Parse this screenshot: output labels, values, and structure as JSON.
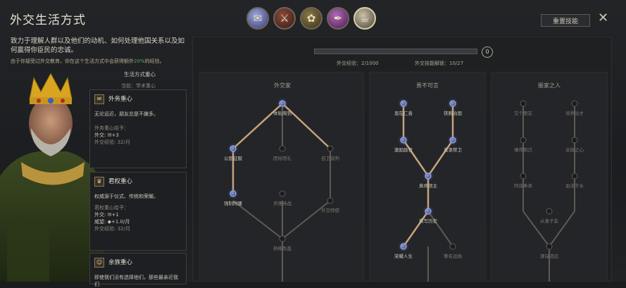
{
  "header": {
    "title": "外交生活方式",
    "reset_label": "重置技能",
    "close_glyph": "✕",
    "tabs": [
      {
        "name": "diplomacy-tab",
        "glyph": "✉",
        "active": false
      },
      {
        "name": "martial-tab",
        "glyph": "⚔",
        "active": false
      },
      {
        "name": "stewardship-tab",
        "glyph": "✿",
        "active": false
      },
      {
        "name": "intrigue-tab",
        "glyph": "✒",
        "active": false
      },
      {
        "name": "learning-tab",
        "glyph": "☕",
        "active": true
      }
    ]
  },
  "left": {
    "description": "致力于理解人群以及他们的动机、如何处理他国关系以及如何赢得你臣民的忠诚。",
    "education_note_pre": "由于你接受过外交教育，你在这个生活方式中会获得额外",
    "education_note_hl": "20%",
    "education_note_post": "的经验。",
    "lifestyle_focus_label": "生活方式重心",
    "current_label": "当前：学术重心",
    "cards": [
      {
        "icon": "✉",
        "title": "外务重心",
        "desc": "无论远近，朋友总是不嫌多。",
        "gain_label": "外务重心给予：",
        "stat1": "外交: ✉+3",
        "stat2": "外交经验: 32/月"
      },
      {
        "icon": "♛",
        "title": "君权重心",
        "desc": "权威源于仪式、传统和荣耀。",
        "gain_label": "君权重心给予：",
        "stat1": "外交: ✉+1",
        "stat2": "威望: ◆+1.0/月",
        "stat3": "外交经验: 32/月"
      },
      {
        "icon": "☺",
        "title": "亲族重心",
        "desc": "即使我们没有选择他们，那些最亲近我们"
      }
    ]
  },
  "progress": {
    "level_value": "0",
    "fill_fraction": 0.0,
    "xp_label": "外交经验：2/1000",
    "unlocked_label": "外交技能解锁：10/27"
  },
  "columns": [
    {
      "title": "外交家",
      "nodes": [
        {
          "label": "体贴周到",
          "on": true
        },
        {
          "label": "公国征服",
          "on": true
        },
        {
          "label": "因俗而礼",
          "on": false
        },
        {
          "label": "自卫谈判",
          "on": false
        },
        {
          "label": "强制附庸",
          "on": true
        },
        {
          "label": "灵便待战",
          "on": false
        },
        {
          "label": "外交特使",
          "on": false
        },
        {
          "label": "熟练伪盖",
          "on": false
        }
      ]
    },
    {
      "title": "贵不可言",
      "nodes": [
        {
          "label": "恩在仁善",
          "on": true
        },
        {
          "label": "铁腕治国",
          "on": true
        },
        {
          "label": "激励励世",
          "on": true
        },
        {
          "label": "直隶禁卫",
          "on": true
        },
        {
          "label": "真命领主",
          "on": true
        },
        {
          "label": "撰写历史",
          "on": true
        },
        {
          "label": "荣耀人生",
          "on": true
        },
        {
          "label": "尊名远扬",
          "on": false
        }
      ]
    },
    {
      "title": "振家之人",
      "nodes": [
        {
          "label": "交个朋友",
          "on": false
        },
        {
          "label": "培养出才",
          "on": false
        },
        {
          "label": "难得知己",
          "on": false
        },
        {
          "label": "亲族之心",
          "on": false
        },
        {
          "label": "阿谀奉承",
          "on": false
        },
        {
          "label": "血浓于水",
          "on": false
        },
        {
          "label": "从善于友",
          "on": false
        },
        {
          "label": "源深流远",
          "on": false
        }
      ]
    }
  ]
}
